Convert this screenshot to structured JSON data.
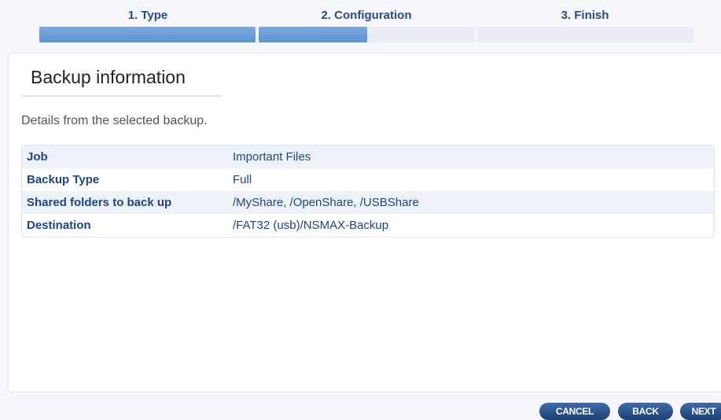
{
  "wizard": {
    "steps": [
      {
        "label": "1. Type",
        "progress": 1.0
      },
      {
        "label": "2. Configuration",
        "progress": 0.5
      },
      {
        "label": "3. Finish",
        "progress": 0.0
      }
    ]
  },
  "panel": {
    "title": "Backup information",
    "description": "Details from the selected backup.",
    "rows": [
      {
        "key": "Job",
        "value": "Important Files"
      },
      {
        "key": "Backup Type",
        "value": "Full"
      },
      {
        "key": "Shared folders to back up",
        "value": "/MyShare, /OpenShare, /USBShare"
      },
      {
        "key": "Destination",
        "value": "/FAT32 (usb)/NSMAX-Backup"
      }
    ]
  },
  "buttons": {
    "cancel": "CANCEL",
    "back": "BACK",
    "next": "NEXT"
  },
  "colors": {
    "accent": "#5f93d2",
    "button": "#1d3f73",
    "label_text": "#1f4485"
  }
}
